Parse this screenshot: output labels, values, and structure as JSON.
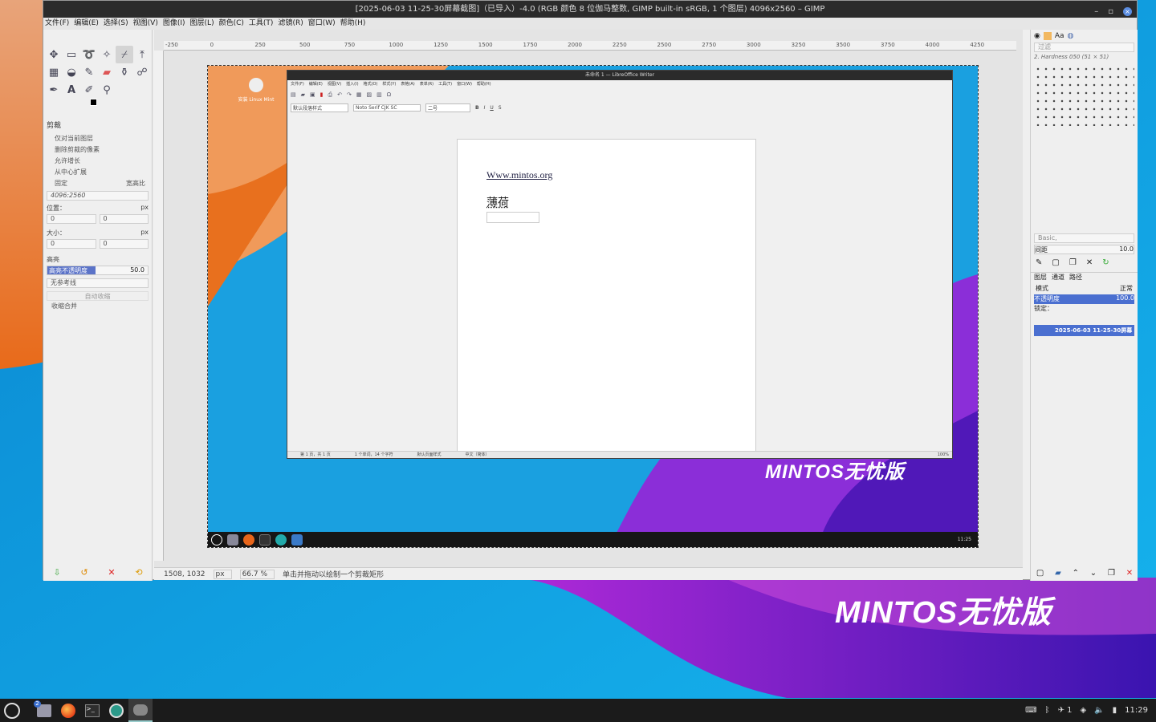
{
  "desktop": {
    "brand": "MINTOS无忧版"
  },
  "gimp": {
    "title": "[2025-06-03 11-25-30屏幕截图]（已导入）-4.0 (RGB 颜色 8 位伽马整数, GIMP built-in sRGB, 1 个图层) 4096x2560 – GIMP",
    "menu": [
      "文件(F)",
      "编辑(E)",
      "选择(S)",
      "视图(V)",
      "图像(I)",
      "图层(L)",
      "颜色(C)",
      "工具(T)",
      "滤镜(R)",
      "窗口(W)",
      "帮助(H)"
    ],
    "ruler_ticks": [
      "-250",
      "0",
      "250",
      "500",
      "750",
      "1000",
      "1250",
      "1500",
      "1750",
      "2000",
      "2250",
      "2500",
      "2750",
      "3000",
      "3250",
      "3500",
      "3750",
      "4000",
      "4250"
    ],
    "tool_options": {
      "title": "剪裁",
      "opts": [
        "仅对当前图层",
        "删除剪裁的像素",
        "允许增长",
        "从中心扩展"
      ],
      "fixed": "固定",
      "aspect": "宽高比",
      "aspect_value": "4096:2560",
      "position_label": "位置：",
      "position_unit": "px",
      "pos_x": "0",
      "pos_y": "0",
      "size_label": "大小：",
      "size_unit": "px",
      "size_x": "0",
      "size_y": "0",
      "highlight": "高亮",
      "highlight_opacity_label": "高亮不透明度",
      "highlight_opacity_value": "50.0",
      "guides": "无参考线",
      "auto_shrink": "自动收缩",
      "shrink_merged": "收缩合并"
    },
    "status": {
      "coords": "1508, 1032",
      "unit": "px",
      "zoom": "66.7 %",
      "message": "单击并拖动以绘制一个剪裁矩形"
    },
    "dock": {
      "filter_placeholder": "过滤",
      "brush_name": "2. Hardness 050 (51 × 51)",
      "preset": "Basic,",
      "spacing_label": "间距",
      "spacing_value": "10.0",
      "tabs": [
        "图层",
        "通道",
        "路径"
      ],
      "mode_label": "模式",
      "mode_value": "正常",
      "opacity_label": "不透明度",
      "opacity_value": "100.0",
      "lock_label": "锁定：",
      "layer_name": "2025-06-03 11-25-30屏幕"
    }
  },
  "inner": {
    "desktop_icon": "安装 Linux Mint",
    "writer_title": "未命名 1 — LibreOffice Writer",
    "writer_menu": [
      "文件(F)",
      "编辑(E)",
      "视图(V)",
      "插入(I)",
      "格式(O)",
      "样式(Y)",
      "表格(A)",
      "表单(R)",
      "工具(T)",
      "窗口(W)",
      "帮助(H)"
    ],
    "para_style": "默认段落样式",
    "font": "Noto Serif CJK SC",
    "font_size": "二号",
    "doc_line1": "Www.mintos.org",
    "doc_line2": "薄荷",
    "status_page": "第 1 页，共 1 页",
    "status_words": "1 个单词，14 个字符",
    "status_style": "默认页面样式",
    "status_lang": "中文（简体）",
    "status_zoom": "100%",
    "clock": "11:25"
  },
  "taskbar": {
    "clock": "11:29",
    "badge": "2",
    "bt": "1"
  },
  "colors": {
    "accent": "#4a6fd0",
    "purple": "#8a2be2"
  }
}
